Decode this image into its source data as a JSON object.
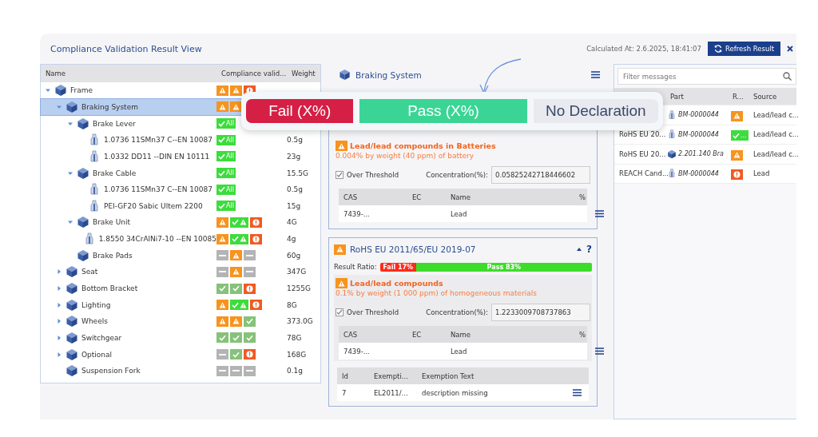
{
  "header": {
    "title": "Compliance Validation Result View",
    "calculated": "Calculated At: 2.6.2025, 18:41:07",
    "refresh_button": "Refresh Result"
  },
  "tree": {
    "columns": [
      "Name",
      "Compliance valid...",
      "Weight"
    ],
    "items": [
      {
        "name": "Frame",
        "kind": "assembly",
        "expanded": true,
        "selected": false,
        "status": [
          {
            "kind": "warn"
          },
          {
            "kind": "warn"
          },
          {
            "kind": "fail"
          }
        ],
        "children": [
          {
            "name": "Braking System",
            "kind": "assembly",
            "expanded": true,
            "selected": true,
            "status": [
              {
                "kind": "warn"
              },
              {
                "kind": "warn"
              }
            ],
            "children": [
              {
                "name": "Brake Lever",
                "kind": "assembly",
                "expanded": true,
                "selected": false,
                "status": [
                  {
                    "kind": "pass_all",
                    "label": "All"
                  }
                ],
                "children": [
                  {
                    "name": "1.0736 11SMn37 C--EN 10087",
                    "kind": "material",
                    "selected": false,
                    "weight": "0.5g",
                    "status": [
                      {
                        "kind": "pass_all",
                        "label": "All"
                      }
                    ]
                  },
                  {
                    "name": "1.0332 DD11 --DIN EN 10111",
                    "kind": "material",
                    "selected": false,
                    "weight": "23g",
                    "status": [
                      {
                        "kind": "pass_all",
                        "label": "All"
                      }
                    ]
                  }
                ]
              },
              {
                "name": "Brake Cable",
                "kind": "assembly",
                "expanded": true,
                "selected": false,
                "weight": "15.5G",
                "status": [
                  {
                    "kind": "pass_all",
                    "label": "All"
                  }
                ],
                "children": [
                  {
                    "name": "1.0736 11SMn37 C--EN 10087",
                    "kind": "material",
                    "selected": false,
                    "weight": "0.5g",
                    "status": [
                      {
                        "kind": "pass_all",
                        "label": "All"
                      }
                    ]
                  },
                  {
                    "name": "PEI-GF20 Sabic Ultem 2200",
                    "kind": "material",
                    "selected": false,
                    "weight": "15g",
                    "status": [
                      {
                        "kind": "pass_all",
                        "label": "All"
                      }
                    ]
                  }
                ]
              },
              {
                "name": "Brake Unit",
                "kind": "assembly",
                "expanded": true,
                "selected": false,
                "weight": "4G",
                "status": [
                  {
                    "kind": "warn"
                  },
                  {
                    "kind": "pass_warn"
                  },
                  {
                    "kind": "fail"
                  }
                ],
                "children": [
                  {
                    "name": "1.8550 34CrAlNi7-10 --EN 10085",
                    "kind": "material",
                    "selected": false,
                    "weight": "4g",
                    "status": [
                      {
                        "kind": "warn"
                      },
                      {
                        "kind": "pass_warn"
                      },
                      {
                        "kind": "fail"
                      }
                    ]
                  }
                ]
              },
              {
                "name": "Brake Pads",
                "kind": "part",
                "selected": false,
                "weight": "60g",
                "status": [
                  {
                    "kind": "none"
                  },
                  {
                    "kind": "warn"
                  },
                  {
                    "kind": "none"
                  }
                ]
              }
            ]
          },
          {
            "name": "Seat",
            "kind": "assembly",
            "expanded": false,
            "selected": false,
            "weight": "347G",
            "status": [
              {
                "kind": "none"
              },
              {
                "kind": "warn"
              },
              {
                "kind": "none"
              }
            ]
          },
          {
            "name": "Bottom Bracket",
            "kind": "assembly",
            "expanded": false,
            "selected": false,
            "weight": "1255G",
            "status": [
              {
                "kind": "pass"
              },
              {
                "kind": "pass"
              },
              {
                "kind": "fail"
              }
            ]
          },
          {
            "name": "Lighting",
            "kind": "assembly",
            "expanded": false,
            "selected": false,
            "weight": "8G",
            "status": [
              {
                "kind": "warn"
              },
              {
                "kind": "pass_warn"
              },
              {
                "kind": "fail"
              }
            ]
          },
          {
            "name": "Wheels",
            "kind": "assembly",
            "expanded": false,
            "selected": false,
            "weight": "373.0G",
            "status": [
              {
                "kind": "warn"
              },
              {
                "kind": "warn"
              },
              {
                "kind": "pass"
              }
            ]
          },
          {
            "name": "Switchgear",
            "kind": "assembly",
            "expanded": false,
            "selected": false,
            "weight": "78G",
            "status": [
              {
                "kind": "pass"
              },
              {
                "kind": "pass"
              },
              {
                "kind": "pass"
              }
            ]
          },
          {
            "name": "Optional",
            "kind": "assembly",
            "expanded": false,
            "selected": false,
            "weight": "168G",
            "status": [
              {
                "kind": "none"
              },
              {
                "kind": "pass"
              },
              {
                "kind": "fail"
              }
            ]
          },
          {
            "name": "Suspension Fork",
            "kind": "part",
            "selected": false,
            "weight": "0.1g",
            "status": [
              {
                "kind": "none"
              },
              {
                "kind": "none"
              },
              {
                "kind": "none"
              }
            ]
          }
        ]
      }
    ]
  },
  "detail": {
    "title": "Braking System",
    "cards": [
      {
        "finding": {
          "title": "Lead/lead compounds in Batteries",
          "subtitle": "0.004% by weight (40 ppm) of battery",
          "over_threshold": true,
          "threshold_label": "Over Threshold",
          "concentration_label": "Concentration(%):",
          "concentration": "0.05825242718446602",
          "columns": [
            "CAS",
            "EC",
            "Name",
            "%"
          ],
          "rows": [
            {
              "cas": "7439-...",
              "name": "Lead"
            }
          ]
        }
      },
      {
        "title": "RoHS EU 2011/65/EU 2019-07",
        "expanded": true,
        "help": "?",
        "ratio_label": "Result Ratio:",
        "ratio": [
          {
            "kind": "fail",
            "label": "Fail 17%",
            "level": 0.17
          },
          {
            "kind": "pass",
            "label": "Pass 83%",
            "level": 0.83
          }
        ],
        "finding": {
          "title": "Lead/lead compounds",
          "subtitle": "0.1% by weight (1 000 ppm) of homogeneous materials",
          "over_threshold": true,
          "threshold_label": "Over Threshold",
          "concentration_label": "Concentration(%):",
          "concentration": "1.2233009708737863",
          "columns": [
            "CAS",
            "EC",
            "Name",
            "%"
          ],
          "rows": [
            {
              "cas": "7439-...",
              "name": "Lead"
            }
          ]
        },
        "exemptions": {
          "columns": [
            "Id",
            "Exempti...",
            "Exemption Text"
          ],
          "rows": [
            {
              "id": "7",
              "code": "EL2011/...",
              "text": "description missing"
            }
          ]
        }
      }
    ]
  },
  "messages": {
    "placeholder": "Filter messages",
    "columns": [
      "Part",
      "R...",
      "Source"
    ],
    "rows": [
      {
        "part": {
          "kind": "material",
          "label": "BM-0000044"
        },
        "result": {
          "kind": "warn"
        },
        "source": "Lead/lead c..."
      },
      {
        "regulation": "RoHS EU 20...",
        "part": {
          "kind": "material",
          "label": "BM-0000044"
        },
        "result": {
          "kind": "pass_all",
          "label": "..."
        },
        "source": "Lead/lead c..."
      },
      {
        "regulation": "RoHS EU 20...",
        "part": {
          "kind": "assembly",
          "label": "2.201.140 Bra"
        },
        "result": {
          "kind": "warn"
        },
        "source": "Lead/lead c..."
      },
      {
        "regulation": "REACH Cand...",
        "part": {
          "kind": "material",
          "label": "BM-0000044"
        },
        "result": {
          "kind": "fail"
        },
        "source": "Lead"
      }
    ]
  },
  "legend": [
    {
      "kind": "fail",
      "label": "Fail (X%)"
    },
    {
      "kind": "pass",
      "label": "Pass (X%)"
    },
    {
      "kind": "none",
      "label": "No Declaration"
    }
  ]
}
